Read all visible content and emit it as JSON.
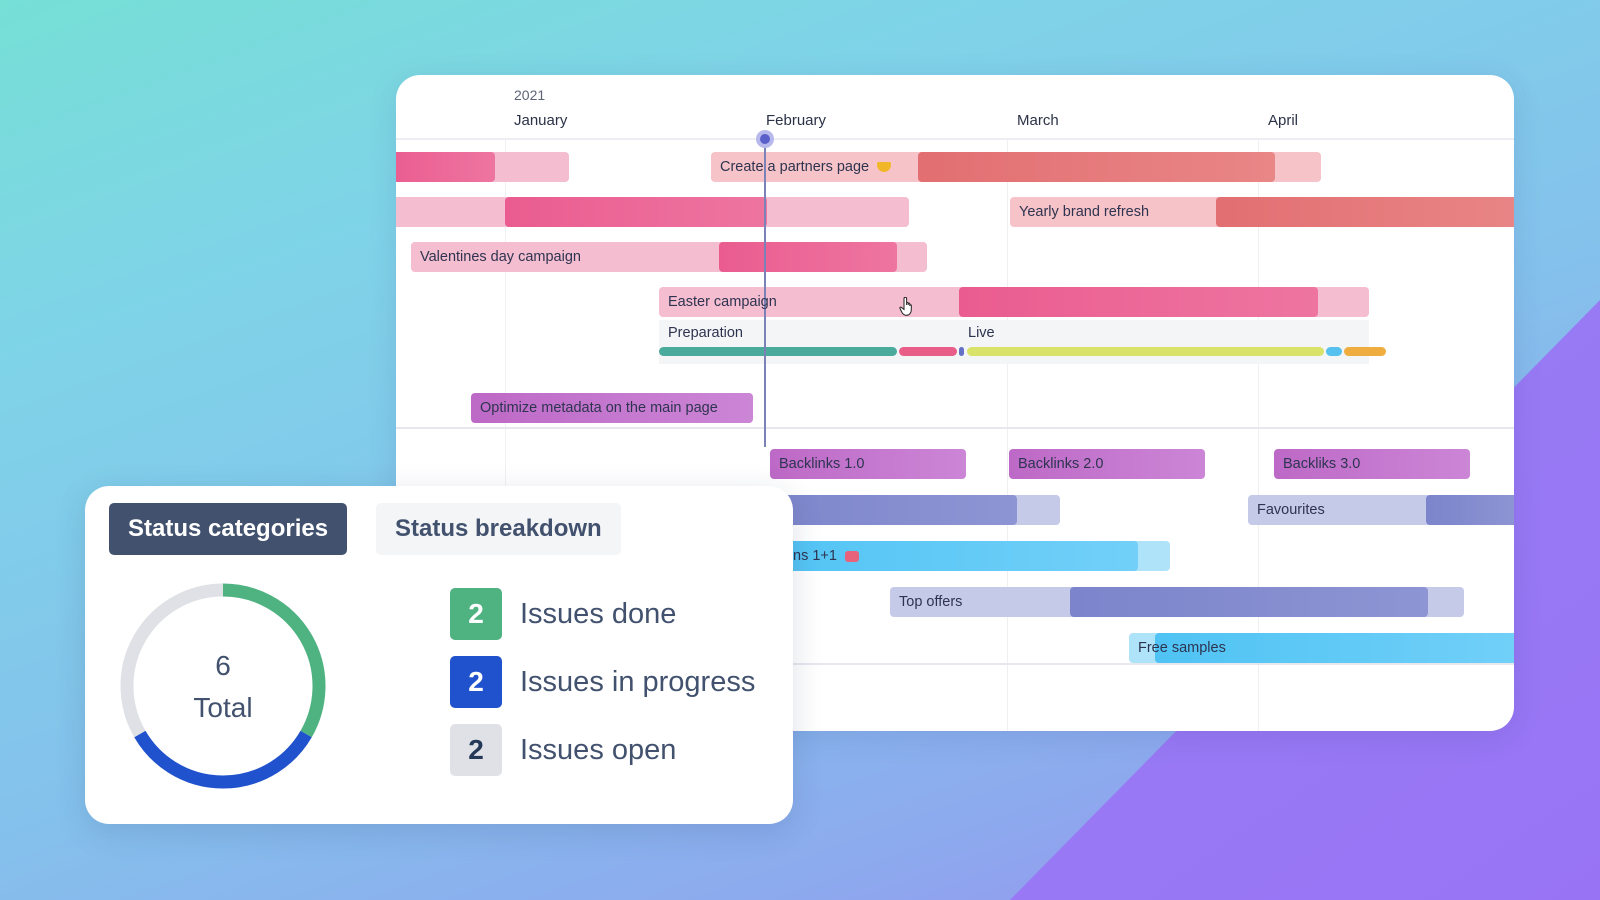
{
  "colors": {
    "done": "#4fb281",
    "in_progress": "#1f52cc",
    "open": "#dfe1e6",
    "accent_dark": "#42526e"
  },
  "timeline": {
    "year": "2021",
    "months": [
      "January",
      "February",
      "March",
      "April"
    ],
    "today_marker": "today",
    "tasks": [
      {
        "label": "",
        "color": "pink"
      },
      {
        "label": "Create a partners page",
        "icon": "heart-emoji",
        "color": "red"
      },
      {
        "label": "",
        "color": "pink"
      },
      {
        "label": "Yearly brand refresh",
        "color": "red"
      },
      {
        "label": "Valentines day campaign",
        "color": "pink"
      },
      {
        "label": "Easter campaign",
        "color": "pink"
      },
      {
        "label": "Optimize metadata on the main page",
        "color": "purple"
      },
      {
        "label": "Backlinks 1.0",
        "color": "purple"
      },
      {
        "label": "Backlinks 2.0",
        "color": "purple"
      },
      {
        "label": "Backliks 3.0",
        "color": "purple"
      },
      {
        "label": "",
        "color": "blue"
      },
      {
        "label": "Favourites",
        "color": "blue"
      },
      {
        "label": "ns 1+1",
        "icon": "gift-emoji",
        "color": "cyan"
      },
      {
        "label": "Top offers",
        "color": "blue"
      },
      {
        "label": "Free samples",
        "color": "cyan"
      }
    ],
    "phases": [
      {
        "label": "Preparation"
      },
      {
        "label": "Live"
      }
    ]
  },
  "status_card": {
    "tabs": [
      {
        "label": "Status categories",
        "active": true
      },
      {
        "label": "Status breakdown",
        "active": false
      }
    ],
    "total_value": "6",
    "total_label": "Total",
    "legend": [
      {
        "count": "2",
        "label": "Issues done",
        "status": "done"
      },
      {
        "count": "2",
        "label": "Issues in progress",
        "status": "in_progress"
      },
      {
        "count": "2",
        "label": "Issues open",
        "status": "open"
      }
    ]
  },
  "chart_data": {
    "type": "pie",
    "title": "Status categories",
    "center_label": "6 Total",
    "categories": [
      "Issues done",
      "Issues in progress",
      "Issues open"
    ],
    "values": [
      2,
      2,
      2
    ],
    "colors": [
      "#4fb281",
      "#1f52cc",
      "#dfe1e6"
    ]
  }
}
